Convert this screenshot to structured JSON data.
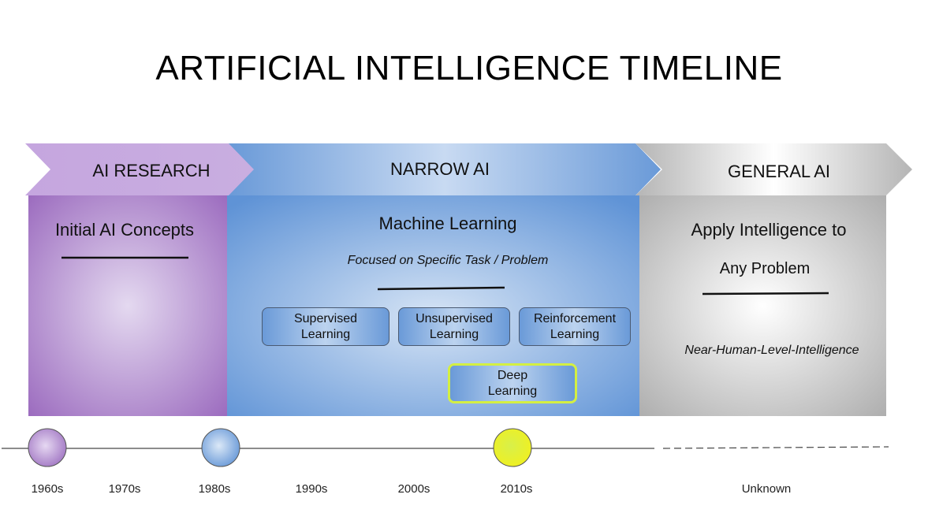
{
  "title": "ARTIFICIAL INTELLIGENCE TIMELINE",
  "phases": [
    {
      "label": "AI RESEARCH",
      "heading": "Initial AI Concepts",
      "color": "#a278c4"
    },
    {
      "label": "NARROW AI",
      "heading": "Machine Learning",
      "subtitle": "Focused on Specific Task / Problem",
      "color": "#6a9ad8",
      "boxes": [
        {
          "line1": "Supervised",
          "line2": "Learning"
        },
        {
          "line1": "Unsupervised",
          "line2": "Learning"
        },
        {
          "line1": "Reinforcement",
          "line2": "Learning"
        },
        {
          "line1": "Deep",
          "line2": "Learning",
          "highlight": "#d4ef42"
        }
      ]
    },
    {
      "label": "GENERAL AI",
      "heading_line1": "Apply Intelligence to",
      "heading_line2": "Any Problem",
      "subtitle": "Near-Human-Level-Intelligence",
      "color": "#bdbdbd"
    }
  ],
  "timeline": {
    "labels": [
      "1960s",
      "1970s",
      "1980s",
      "1990s",
      "2000s",
      "2010s",
      "Unknown"
    ],
    "markers": [
      {
        "year": "1960s",
        "color": "#a278c4"
      },
      {
        "year": "1980s",
        "color": "#6a9ad8"
      },
      {
        "year": "2010s",
        "color": "#e3f23a"
      }
    ]
  }
}
